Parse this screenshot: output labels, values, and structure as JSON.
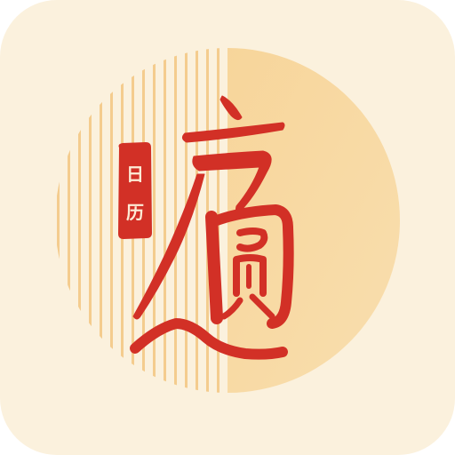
{
  "app_icon": {
    "seal": {
      "char_top": "日",
      "char_bottom": "历"
    },
    "calligraphy_logo": "方圆",
    "colors": {
      "background": "#fbf1dd",
      "moon_fill": "#f7cf8c",
      "stripe": "#f3c886",
      "brush_red": "#d23026",
      "seal_red": "#d23026"
    }
  }
}
